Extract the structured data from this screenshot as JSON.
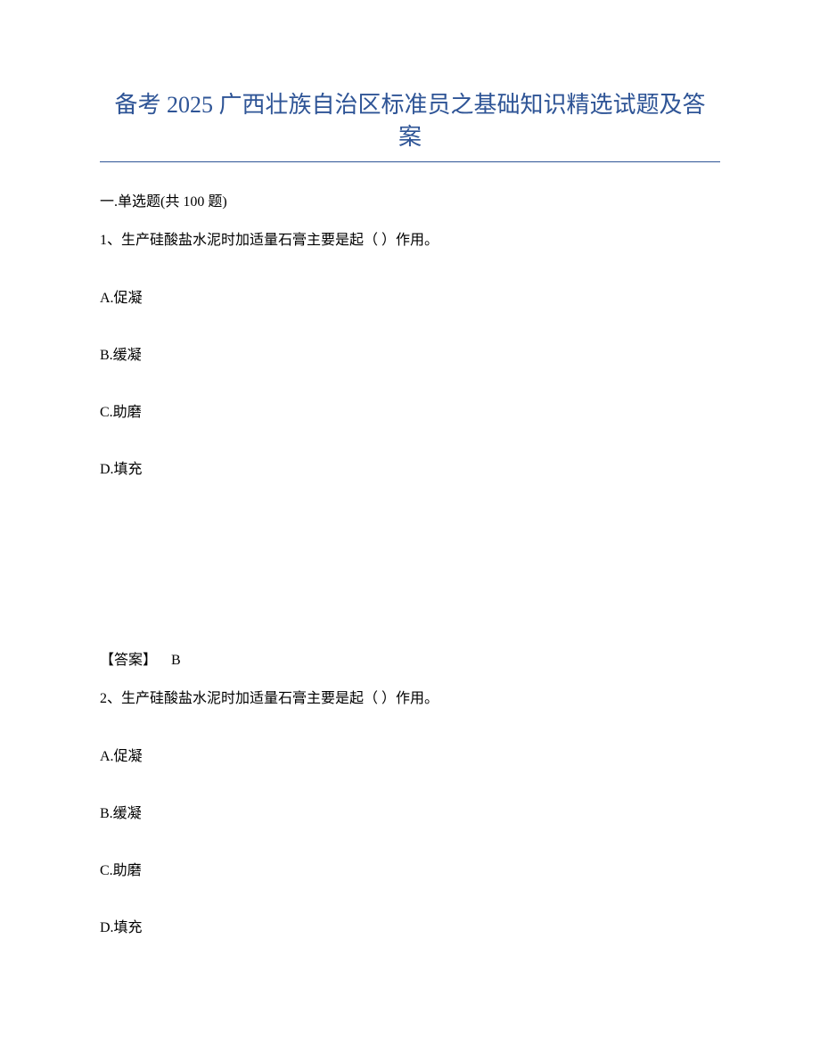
{
  "title": "备考 2025 广西壮族自治区标准员之基础知识精选试题及答案",
  "section_header": "一.单选题(共 100 题)",
  "q1": {
    "stem": "1、生产硅酸盐水泥时加适量石膏主要是起（ ）作用。",
    "optA": "A.促凝",
    "optB": "B.缓凝",
    "optC": "C.助磨",
    "optD": "D.填充",
    "answer_label": "【答案】",
    "answer_value": "B"
  },
  "q2": {
    "stem": "2、生产硅酸盐水泥时加适量石膏主要是起（ ）作用。",
    "optA": "A.促凝",
    "optB": "B.缓凝",
    "optC": "C.助磨",
    "optD": "D.填充"
  }
}
